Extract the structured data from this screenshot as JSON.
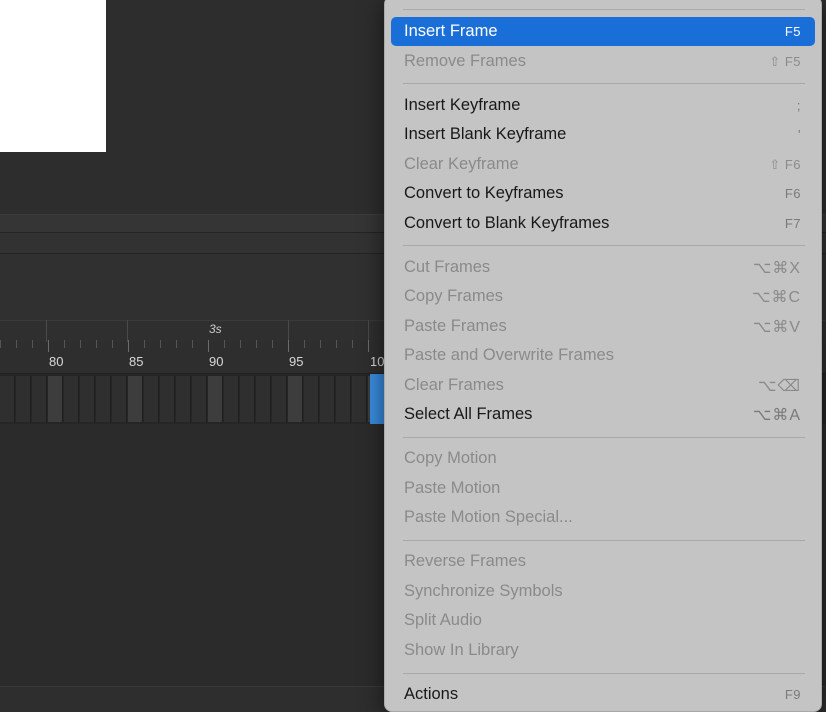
{
  "timeline": {
    "seconds_marker": "3s",
    "frame_numbers": [
      "80",
      "85",
      "90",
      "95",
      "10"
    ]
  },
  "menu": {
    "items": [
      {
        "label": "Insert Frame",
        "shortcut": "F5",
        "enabled": true,
        "highlighted": true
      },
      {
        "label": "Remove Frames",
        "shortcut": "⇧ F5",
        "enabled": false
      },
      {
        "label": "Insert Keyframe",
        "shortcut": ";",
        "enabled": true
      },
      {
        "label": "Insert Blank Keyframe",
        "shortcut": "'",
        "enabled": true
      },
      {
        "label": "Clear Keyframe",
        "shortcut": "⇧ F6",
        "enabled": false
      },
      {
        "label": "Convert to Keyframes",
        "shortcut": "F6",
        "enabled": true
      },
      {
        "label": "Convert to Blank Keyframes",
        "shortcut": "F7",
        "enabled": true
      },
      {
        "label": "Cut Frames",
        "shortcut": "⌥⌘X",
        "enabled": false
      },
      {
        "label": "Copy Frames",
        "shortcut": "⌥⌘C",
        "enabled": false
      },
      {
        "label": "Paste Frames",
        "shortcut": "⌥⌘V",
        "enabled": false
      },
      {
        "label": "Paste and Overwrite Frames",
        "shortcut": "",
        "enabled": false
      },
      {
        "label": "Clear Frames",
        "shortcut": "⌥⌫",
        "enabled": false
      },
      {
        "label": "Select All Frames",
        "shortcut": "⌥⌘A",
        "enabled": true
      },
      {
        "label": "Copy Motion",
        "shortcut": "",
        "enabled": false
      },
      {
        "label": "Paste Motion",
        "shortcut": "",
        "enabled": false
      },
      {
        "label": "Paste Motion Special...",
        "shortcut": "",
        "enabled": false
      },
      {
        "label": "Reverse Frames",
        "shortcut": "",
        "enabled": false
      },
      {
        "label": "Synchronize Symbols",
        "shortcut": "",
        "enabled": false
      },
      {
        "label": "Split Audio",
        "shortcut": "",
        "enabled": false
      },
      {
        "label": "Show In Library",
        "shortcut": "",
        "enabled": false
      },
      {
        "label": "Actions",
        "shortcut": "F9",
        "enabled": true
      }
    ]
  },
  "colors": {
    "highlight": "#1a6ed8",
    "menu_bg": "#c4c4c4",
    "playhead": "#3a8ce0"
  }
}
